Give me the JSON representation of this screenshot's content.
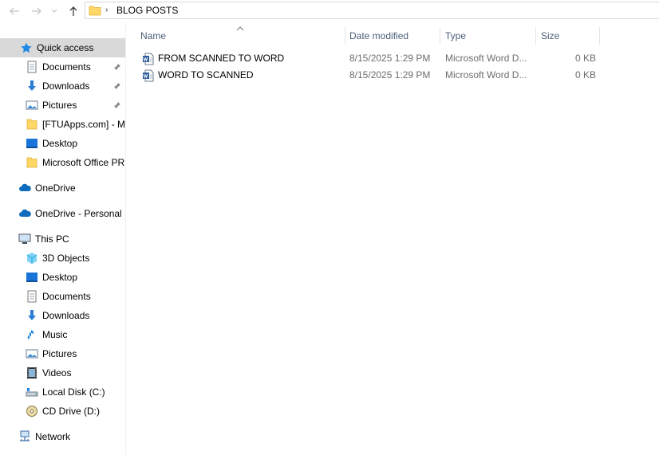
{
  "address": {
    "separator": "›",
    "path": "BLOG POSTS"
  },
  "columns": {
    "name": "Name",
    "date": "Date modified",
    "type": "Type",
    "size": "Size"
  },
  "files": [
    {
      "name": "FROM SCANNED TO WORD",
      "date": "8/15/2025 1:29 PM",
      "type": "Microsoft Word D...",
      "size": "0 KB",
      "icon": "word-doc-icon"
    },
    {
      "name": "WORD TO SCANNED",
      "date": "8/15/2025 1:29 PM",
      "type": "Microsoft Word D...",
      "size": "0 KB",
      "icon": "word-doc-icon"
    }
  ],
  "sidebar": {
    "quick_access": "Quick access",
    "qa_items": [
      "Documents",
      "Downloads",
      "Pictures",
      "[FTUApps.com] - M",
      "Desktop",
      "Microsoft Office PR"
    ],
    "onedrive": "OneDrive",
    "onedrive_personal": "OneDrive - Personal",
    "this_pc": "This PC",
    "pc_items": [
      "3D Objects",
      "Desktop",
      "Documents",
      "Downloads",
      "Music",
      "Pictures",
      "Videos",
      "Local Disk (C:)",
      "CD Drive (D:)"
    ],
    "network": "Network"
  },
  "colors": {
    "selected": "#d9d9d9",
    "header_text": "#4c607a",
    "folder": "#ffd766",
    "onedrive": "#0f6cbd"
  }
}
